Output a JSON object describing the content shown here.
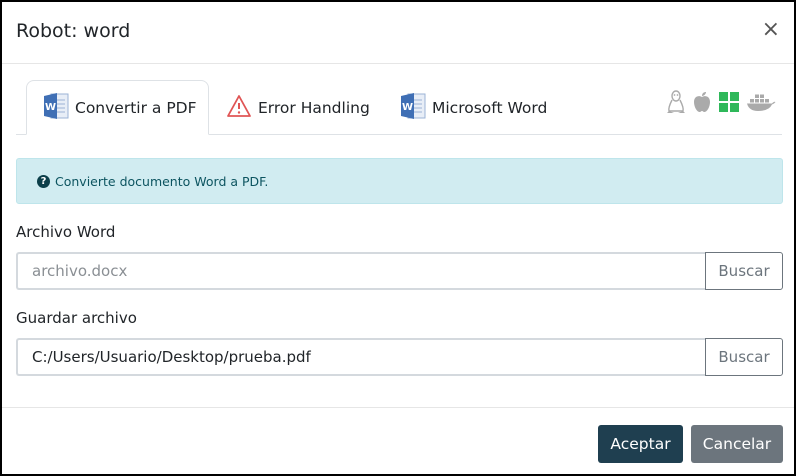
{
  "modal": {
    "title": "Robot: word",
    "close_label": "×"
  },
  "tabs": [
    {
      "label": "Convertir a PDF",
      "icon": "word-icon",
      "active": true
    },
    {
      "label": "Error Handling",
      "icon": "warning-icon",
      "active": false
    },
    {
      "label": "Microsoft Word",
      "icon": "word-icon",
      "active": false
    }
  ],
  "os_icons": [
    "linux-icon",
    "apple-icon",
    "windows-icon",
    "docker-icon"
  ],
  "info": {
    "icon": "question-circle-icon",
    "text": "Convierte documento Word a PDF."
  },
  "fields": [
    {
      "label": "Archivo Word",
      "value": "",
      "placeholder": "archivo.docx",
      "button": "Buscar"
    },
    {
      "label": "Guardar archivo",
      "value": "C:/Users/Usuario/Desktop/prueba.pdf",
      "placeholder": "",
      "button": "Buscar"
    }
  ],
  "footer": {
    "accept_label": "Aceptar",
    "cancel_label": "Cancelar"
  },
  "colors": {
    "accent": "#1f3f50",
    "secondary": "#6c757d",
    "info_bg": "#d1ecf1",
    "windows_green": "#2fb85a",
    "warning_red": "#e05555",
    "word_blue": "#3f6fb5"
  }
}
